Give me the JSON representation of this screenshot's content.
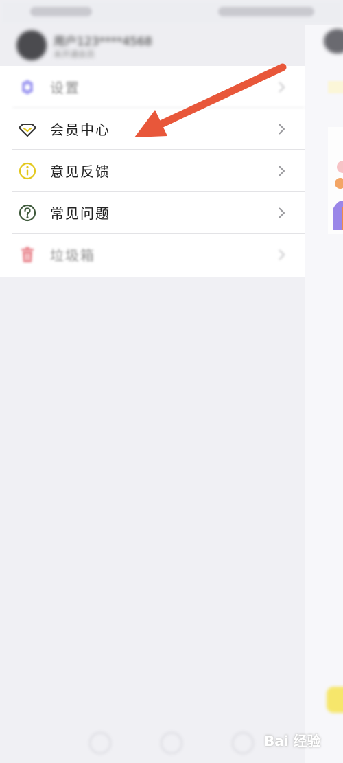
{
  "profile": {
    "name": "用户123****4568",
    "subtitle": "未开通会员"
  },
  "menu": {
    "items": [
      {
        "label": "设置",
        "icon": "gear-icon"
      },
      {
        "label": "会员中心",
        "icon": "diamond-icon"
      },
      {
        "label": "意见反馈",
        "icon": "info-icon"
      },
      {
        "label": "常见问题",
        "icon": "question-icon"
      },
      {
        "label": "垃圾箱",
        "icon": "trash-icon"
      }
    ]
  },
  "colors": {
    "arrow": "#e8573a",
    "info_yellow": "#e3c81d",
    "question_green": "#3f5a3c",
    "trash_red": "#e15b66",
    "gear_purple": "#8a84ee"
  },
  "watermark": {
    "text": "Bai 经验"
  }
}
